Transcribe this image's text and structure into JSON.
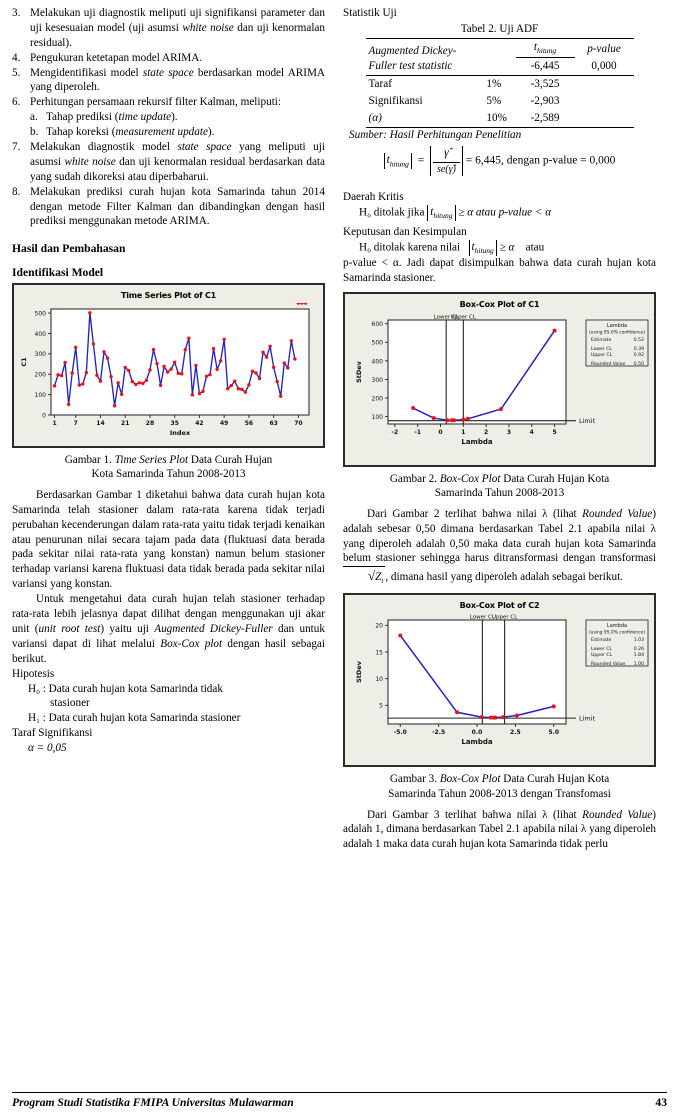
{
  "left_column": {
    "steps": [
      {
        "num": "3.",
        "html": "Melakukan uji diagnostik meliputi uji signifikansi parameter dan uji kesesuaian model (uji asumsi <i>white noise</i> dan uji kenormalan residual)."
      },
      {
        "num": "4.",
        "html": "Pengukuran ketetapan model ARIMA."
      },
      {
        "num": "5.",
        "html": "Mengidentifikasi model <i>state space</i> berdasarkan model ARIMA yang diperoleh."
      },
      {
        "num": "6.",
        "html": "Perhitungan persamaan rekursif filter Kalman, meliputi:"
      },
      {
        "num": "7.",
        "html": "Melakukan diagnostik model <i>state space</i> yang meliputi uji asumsi <i>white noise</i> dan uji kenormalan residual berdasarkan data yang sudah dikoreksi atau diperbaharui."
      },
      {
        "num": "8.",
        "html": "Melakukan prediksi curah hujan kota Samarinda tahun 2014 dengan metode Filter Kalman dan dibandingkan dengan hasil prediksi menggunakan metode ARIMA."
      }
    ],
    "substeps": [
      {
        "num": "a.",
        "html": "Tahap prediksi (<i>time update</i>)."
      },
      {
        "num": "b.",
        "html": "Tahap koreksi (<i>measurement update</i>)."
      }
    ],
    "heading_results": "Hasil dan Pembahasan",
    "heading_identification": "Identifikasi Model",
    "figure1_caption_line1_pre": "Gambar 1. ",
    "figure1_caption_line1_italic": "Time Series Plot",
    "figure1_caption_line1_post": " Data Curah Hujan",
    "figure1_caption_line2": "Kota Samarinda Tahun 2008-2013",
    "paragraph1": "Berdasarkan Gambar 1 diketahui bahwa data curah hujan kota Samarinda telah stasioner dalam rata-rata karena tidak terjadi perubahan kecenderungan dalam rata-rata yaitu tidak terjadi kenaikan atau penurunan nilai secara tajam pada data (fluktuasi data berada pada sekitar nilai rata-rata yang konstan) namun belum stasioner terhadap variansi karena fluktuasi data tidak berada pada sekitar nilai variansi yang konstan.",
    "paragraph2_html": "Untuk mengetahui data curah hujan telah stasioner terhadap rata-rata lebih jelasnya dapat dilihat dengan menggunakan uji akar unit (<i>unit root test</i>) yaitu uji <i>Augmented Dickey-Fuller</i> dan untuk variansi dapat di lihat melalui <i>Box-Cox plot</i> dengan hasil sebagai berikut.",
    "hipotesis_label": "Hipotesis",
    "h0_text": "H₀ :  Data curah hujan kota Samarinda tidak",
    "h0_text_cont": "stasioner",
    "h1_text": "H₁ :  Data curah hujan kota Samarinda stasioner",
    "taraf_label": "Taraf Signifikansi",
    "alpha_value": "α = 0,05"
  },
  "right_column": {
    "statistik_uji_label": "Statistik Uji",
    "table_title": "Tabel 2. Uji ADF",
    "table": {
      "row_label_line1": "Augmented Dickey-",
      "row_label_line2": "Fuller test statistic",
      "header_t": "t",
      "header_t_sub": "hitung",
      "header_p": "p-value",
      "stat_value": "-6,445",
      "p_value": "0,000",
      "sig_rows": [
        {
          "label": "Taraf",
          "level": "1%",
          "value": "-3,525"
        },
        {
          "label": "Signifikansi",
          "level": "5%",
          "value": "-2,903"
        },
        {
          "label": "(α)",
          "level": "10%",
          "value": "-2,589"
        }
      ]
    },
    "source_note": "Sumber: Hasil Perhitungan Penelitian",
    "formula_t": "t",
    "formula_t_sub": "hitung",
    "formula_num": "γ̂",
    "formula_den": "se(γ̂)",
    "formula_eq": "= 6,445, dengan p-value = 0,000",
    "daerah_kritis_label": "Daerah Kritis",
    "daerah_kritis_pre": "H₀ ditolak jika ",
    "daerah_kritis_mid": " ≥ α  atau ",
    "daerah_kritis_post": "p-value < α",
    "keputusan_label": "Keputusan dan Kesimpulan",
    "keputusan_pre": "H₀      ditolak      karena      nilai",
    "keputusan_mid": " ≥ α",
    "keputusan_atau": "atau",
    "keputusan_rest": "p-value < α. Jadi dapat disimpulkan bahwa data curah hujan kota Samarinda stasioner.",
    "figure2_caption_pre": "Gambar 2. ",
    "figure2_caption_italic": "Box-Cox Plot",
    "figure2_caption_post": " Data Curah Hujan Kota",
    "figure2_caption_line2": "Samarinda Tahun 2008-2013",
    "paragraph3_html": "Dari Gambar 2 terlihat bahwa nilai λ (lihat <i>Rounded Value</i>) adalah sebesar 0,50 dimana berdasarkan Tabel 2.1 apabila nilai λ yang diperoleh adalah 0,50 maka data curah hujan kota Samarinda belum stasioner sehingga harus ditransformasi dengan transformasi",
    "paragraph3_tail": ", dimana hasil yang diperoleh adalah sebagai berikut.",
    "sqrt_symbol": "√",
    "sqrt_var": "Z",
    "sqrt_var_sub": "t",
    "figure3_caption_pre": "Gambar 3. ",
    "figure3_caption_italic": "Box-Cox Plot",
    "figure3_caption_post": " Data Curah Hujan Kota",
    "figure3_caption_line2": "Samarinda Tahun 2008-2013 dengan Transfomasi",
    "paragraph4_html": "Dari Gambar 3 terlihat bahwa nilai λ (lihat <i>Rounded Value</i>) adalah 1, dimana berdasarkan Tabel 2.1 apabila nilai λ yang diperoleh adalah 1 maka data curah hujan kota Samarinda tidak perlu"
  },
  "footer": {
    "text": "Program Studi Statistika FMIPA Universitas Mulawarman",
    "page_number": "43"
  },
  "colors": {
    "series_line": "#2222cc",
    "series_marker": "#ee1111",
    "chart_bg": "#efeee6",
    "plot_bg": "#ffffff",
    "frame": "#2b2b2b"
  },
  "chart_data": [
    {
      "id": "time-series-c1",
      "type": "line",
      "title": "Time Series Plot of C1",
      "xlabel": "Index",
      "ylabel": "C1",
      "xlim": [
        0,
        73
      ],
      "ylim": [
        0,
        520
      ],
      "yticks": [
        0,
        100,
        200,
        300,
        400,
        500
      ],
      "xticks": [
        1,
        7,
        14,
        21,
        28,
        35,
        42,
        49,
        56,
        63,
        70
      ],
      "grid": false,
      "markers": true,
      "x": [
        1,
        2,
        3,
        4,
        5,
        6,
        7,
        8,
        9,
        10,
        11,
        12,
        13,
        14,
        15,
        16,
        17,
        18,
        19,
        20,
        21,
        22,
        23,
        24,
        25,
        26,
        27,
        28,
        29,
        30,
        31,
        32,
        33,
        34,
        35,
        36,
        37,
        38,
        39,
        40,
        41,
        42,
        43,
        44,
        45,
        46,
        47,
        48,
        49,
        50,
        51,
        52,
        53,
        54,
        55,
        56,
        57,
        58,
        59,
        60,
        61,
        62,
        63,
        64,
        65,
        66,
        67,
        68,
        69,
        70,
        71,
        72
      ],
      "values": [
        143,
        197,
        193,
        258,
        52,
        206,
        332,
        147,
        152,
        208,
        501,
        348,
        195,
        166,
        310,
        279,
        188,
        45,
        158,
        101,
        233,
        218,
        164,
        150,
        158,
        155,
        170,
        221,
        321,
        252,
        146,
        238,
        211,
        225,
        259,
        205,
        202,
        321,
        377,
        99,
        243,
        105,
        116,
        190,
        198,
        326,
        224,
        265,
        371,
        129,
        144,
        166,
        129,
        126,
        112,
        148,
        215,
        206,
        179,
        308,
        284,
        337,
        234,
        164,
        92,
        255,
        231,
        364,
        275
      ]
    },
    {
      "id": "box-cox-c1",
      "type": "line",
      "title": "Box-Cox Plot of C1",
      "xlabel": "Lambda",
      "ylabel": "StDev",
      "xlim": [
        -2.3,
        5.5
      ],
      "ylim": [
        60,
        620
      ],
      "yticks": [
        100,
        200,
        300,
        400,
        500,
        600
      ],
      "xticks": [
        -2,
        -1,
        0,
        1,
        2,
        3,
        4,
        5
      ],
      "x": [
        -1.2,
        -0.3,
        0.3,
        0.5,
        0.6,
        1.0,
        1.2,
        2.65,
        5.0
      ],
      "values": [
        146,
        92,
        80,
        80,
        80,
        83,
        88,
        140,
        563
      ],
      "lower_cl_x": 0.25,
      "upper_cl_x": 1.0,
      "limit_y": 78,
      "annotations": {
        "lower_cl": "Lower CL",
        "upper_cl": "Upper CL",
        "limit": "Limit"
      },
      "legend": {
        "title": "Lambda",
        "subtitle": "(using 95.0% confidence)",
        "rows": [
          {
            "label": "Estimate",
            "value": "0.52"
          },
          {
            "label": "Lower CL",
            "value": "0.39"
          },
          {
            "label": "Upper CL",
            "value": "0.92"
          },
          {
            "label": "Rounded Value",
            "value": "0.50"
          }
        ]
      }
    },
    {
      "id": "box-cox-c2",
      "type": "line",
      "title": "Box-Cox Plot of C2",
      "xlabel": "Lambda",
      "ylabel": "StDev",
      "xlim": [
        -5.8,
        5.8
      ],
      "ylim": [
        1.5,
        21
      ],
      "yticks": [
        5,
        10,
        15,
        20
      ],
      "xticks": [
        -5.0,
        -2.5,
        0.0,
        2.5,
        5.0
      ],
      "x": [
        -5.0,
        -1.3,
        0.3,
        0.9,
        1.1,
        1.2,
        1.7,
        2.6,
        5.0
      ],
      "values": [
        18.1,
        3.7,
        2.8,
        2.7,
        2.7,
        2.7,
        2.8,
        3.1,
        4.8
      ],
      "lower_cl_x": 0.35,
      "upper_cl_x": 1.8,
      "limit_y": 2.6,
      "annotations": {
        "lower_cl": "Lower CL",
        "upper_cl": "Upper CL",
        "limit": "Limit"
      },
      "legend": {
        "title": "Lambda",
        "subtitle": "(using 95.0% confidence)",
        "rows": [
          {
            "label": "Estimate",
            "value": "1.03"
          },
          {
            "label": "Lower CL",
            "value": "0.26"
          },
          {
            "label": "Upper CL",
            "value": "1.84"
          },
          {
            "label": "Rounded Value",
            "value": "1.00"
          }
        ]
      }
    }
  ]
}
